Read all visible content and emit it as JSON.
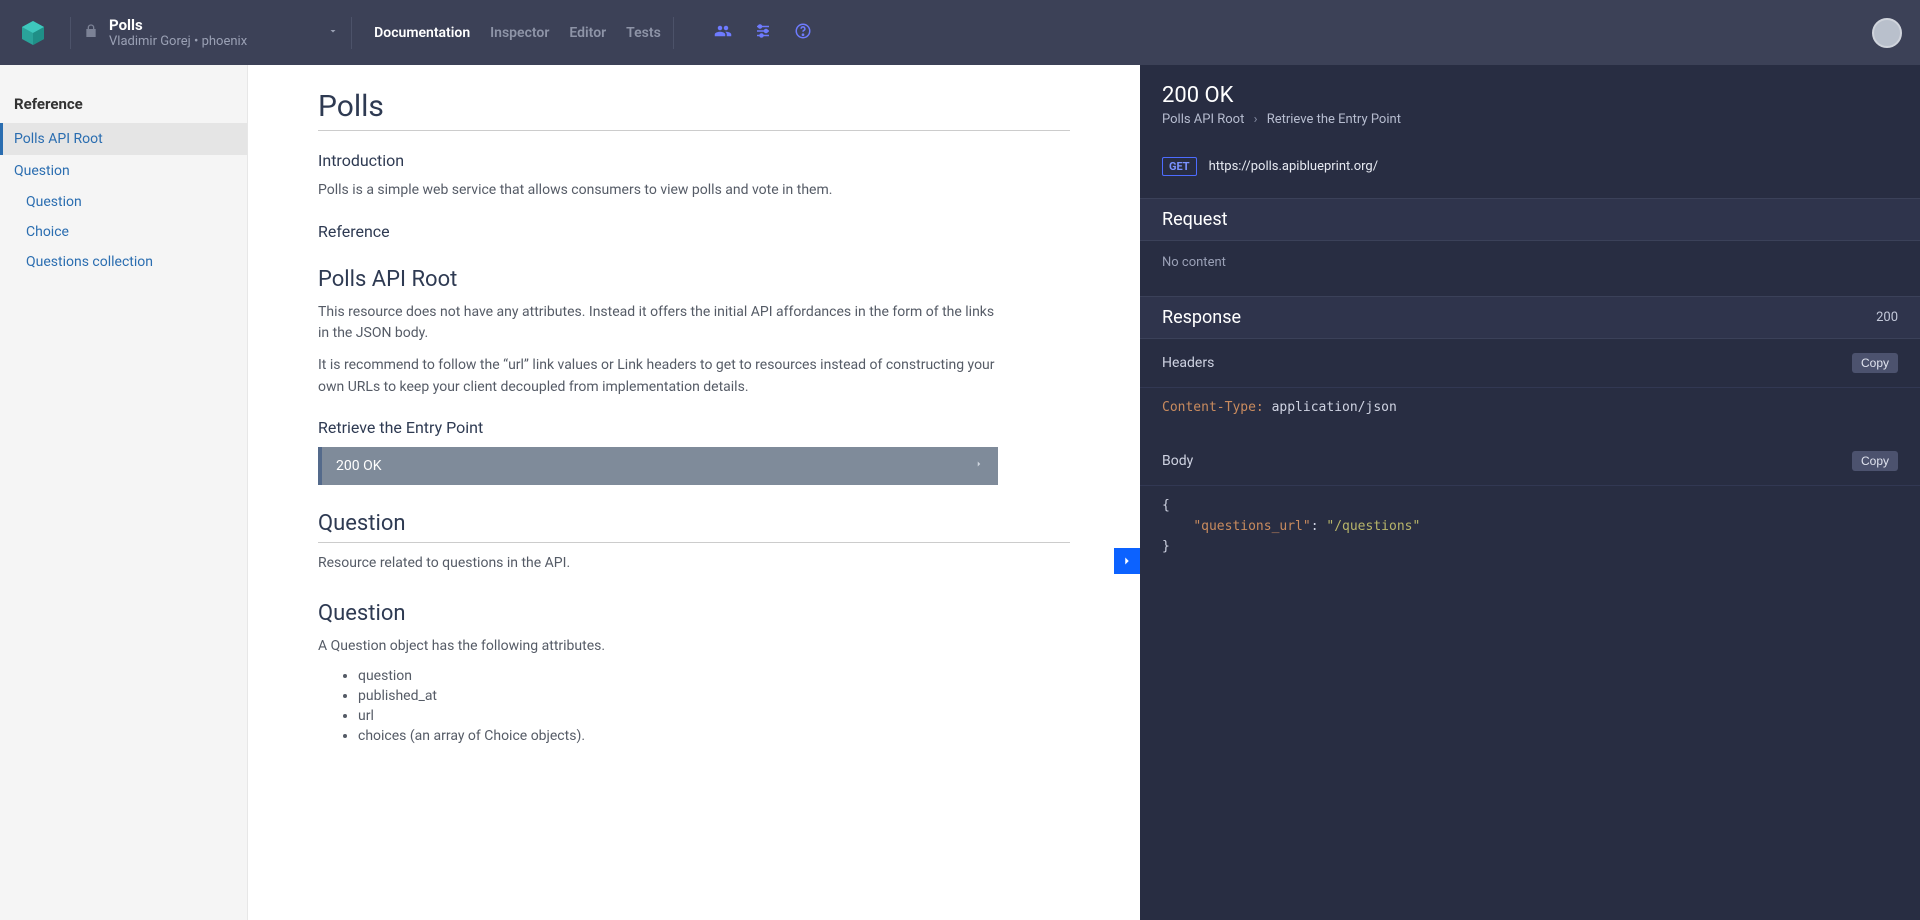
{
  "header": {
    "project_title": "Polls",
    "project_subtitle": "Vladimir Gorej • phoenix",
    "tabs": {
      "documentation": "Documentation",
      "inspector": "Inspector",
      "editor": "Editor",
      "tests": "Tests"
    }
  },
  "sidebar": {
    "heading": "Reference",
    "item_root": "Polls API Root",
    "item_question": "Question",
    "sub_question": "Question",
    "sub_choice": "Choice",
    "sub_collection": "Questions collection"
  },
  "doc": {
    "title": "Polls",
    "intro_h": "Introduction",
    "intro_p": "Polls is a simple web service that allows consumers to view polls and vote in them.",
    "ref_h": "Reference",
    "root_h": "Polls API Root",
    "root_p1": "This resource does not have any attributes. Instead it offers the initial API affordances in the form of the links in the JSON body.",
    "root_p2": "It is recommend to follow the “url” link values or Link headers to get to resources instead of constructing your own URLs to keep your client decoupled from implementation details.",
    "retrieve_h": "Retrieve the Entry Point",
    "status_200": "200 OK",
    "question_h": "Question",
    "question_p": "Resource related to questions in the API.",
    "question_sub_h": "Question",
    "question_attr_p": "A Question object has the following attributes.",
    "attrs": {
      "a1": "question",
      "a2": "published_at",
      "a3": "url",
      "a4": "choices (an array of Choice objects)."
    }
  },
  "panel": {
    "status": "200 OK",
    "crumb1": "Polls API Root",
    "crumb2": "Retrieve the Entry Point",
    "method": "GET",
    "url": "https://polls.apiblueprint.org/",
    "request_h": "Request",
    "no_content": "No content",
    "response_h": "Response",
    "response_code": "200",
    "headers_h": "Headers",
    "copy": "Copy",
    "header_key": "Content-Type:",
    "header_val": "application/json",
    "body_h": "Body",
    "body_open": "{",
    "body_key": "\"questions_url\"",
    "body_colon": ": ",
    "body_val": "\"/questions\"",
    "body_close": "}"
  }
}
